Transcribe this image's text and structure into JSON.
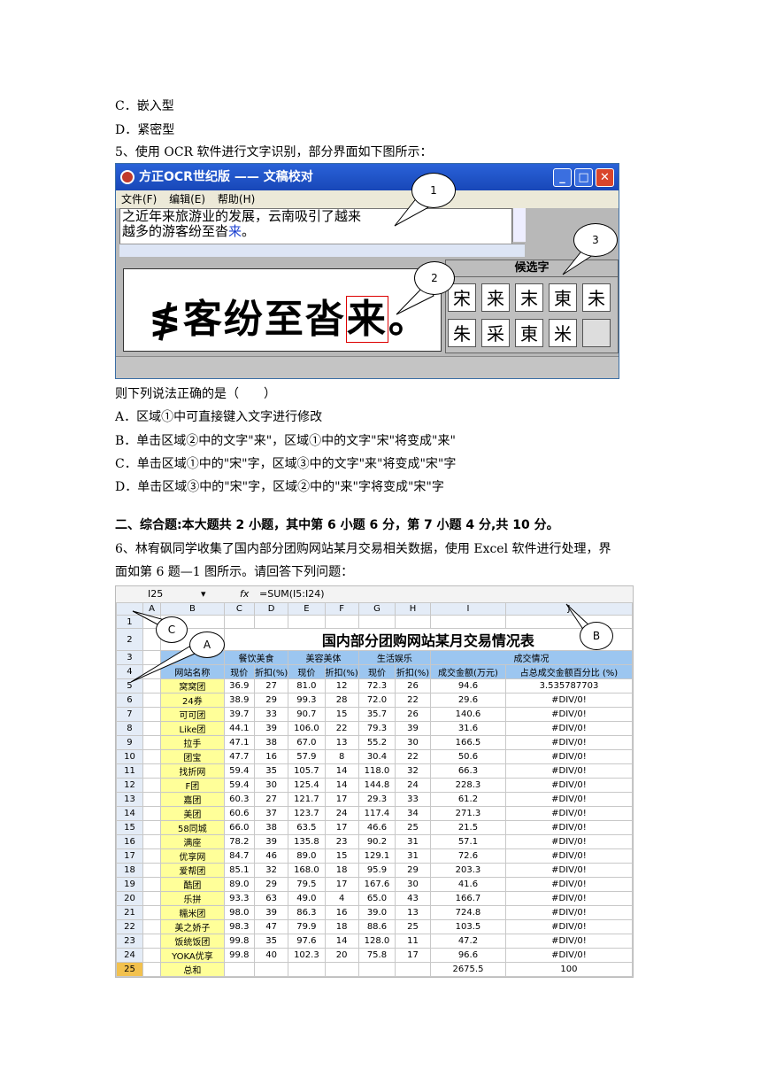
{
  "top_lines": [
    "C．嵌入型",
    "D．紧密型",
    "5、使用 OCR 软件进行文字识别，部分界面如下图所示："
  ],
  "ocr": {
    "title": "方正OCR世纪版  ——  文稿校对",
    "menu": [
      "文件(F)",
      "编辑(E)",
      "帮助(H)"
    ],
    "text_line1": "之近年来旅游业的发展，云南吸引了越来",
    "text_line2_prefix": "越多的游客纷至沓",
    "text_line2_highlight": "来",
    "text_line2_suffix": "。",
    "preview_prefix": "≸客纷至沓",
    "preview_highlight": "来",
    "preview_suffix": "。",
    "candidate_title": "候选字",
    "candidates": [
      "宋",
      "来",
      "末",
      "東",
      "未",
      "朱",
      "采",
      "東",
      "米",
      ""
    ]
  },
  "callouts": [
    "1",
    "2",
    "3"
  ],
  "question": {
    "stem": "则下列说法正确的是（　　）",
    "options": [
      "A．区域①中可直接键入文字进行修改",
      "B．单击区域②中的文字\"来\"，区域①中的文字\"宋\"将变成\"来\"",
      "C．单击区域①中的\"宋\"字，区域③中的文字\"来\"将变成\"宋\"字",
      "D．单击区域③中的\"宋\"字，区域②中的\"来\"字将变成\"宋\"字"
    ]
  },
  "section_title": "二、综合题:本大题共 2 小题，其中第 6 小题 6 分，第 7 小题 4 分,共 10 分。",
  "q6_line1": "6、林宥砜同学收集了国内部分团购网站某月交易相关数据，使用 Excel 软件进行处理，界",
  "q6_line2": "面如第 6 题—1 图所示。请回答下列问题：",
  "excel": {
    "cell_ref": "I25",
    "fx": "fx",
    "formula": "=SUM(I5:I24)",
    "columns": [
      "A",
      "B",
      "C",
      "D",
      "E",
      "F",
      "G",
      "H",
      "I",
      "J"
    ],
    "callouts": [
      "A",
      "B",
      "C"
    ],
    "title": "国内部分团购网站某月交易情况表",
    "group_headers": [
      "餐饮美食",
      "美容美体",
      "生活娱乐",
      "成交情况"
    ],
    "sub_headers": [
      "网站名称",
      "现价",
      "折扣(%)",
      "现价",
      "折扣(%)",
      "现价",
      "折扣(%)",
      "成交金额(万元)",
      "占总成交金额百分比 (%)"
    ],
    "rows": [
      [
        "5",
        "窝窝团",
        "36.9",
        "27",
        "81.0",
        "12",
        "72.3",
        "26",
        "94.6",
        "3.535787703"
      ],
      [
        "6",
        "24券",
        "38.9",
        "29",
        "99.3",
        "28",
        "72.0",
        "22",
        "29.6",
        "#DIV/0!"
      ],
      [
        "7",
        "可可团",
        "39.7",
        "33",
        "90.7",
        "15",
        "35.7",
        "26",
        "140.6",
        "#DIV/0!"
      ],
      [
        "8",
        "Like团",
        "44.1",
        "39",
        "106.0",
        "22",
        "79.3",
        "39",
        "31.6",
        "#DIV/0!"
      ],
      [
        "9",
        "拉手",
        "47.1",
        "38",
        "67.0",
        "13",
        "55.2",
        "30",
        "166.5",
        "#DIV/0!"
      ],
      [
        "10",
        "团宝",
        "47.7",
        "16",
        "57.9",
        "8",
        "30.4",
        "22",
        "50.6",
        "#DIV/0!"
      ],
      [
        "11",
        "找折网",
        "59.4",
        "35",
        "105.7",
        "14",
        "118.0",
        "32",
        "66.3",
        "#DIV/0!"
      ],
      [
        "12",
        "F团",
        "59.4",
        "30",
        "125.4",
        "14",
        "144.8",
        "24",
        "228.3",
        "#DIV/0!"
      ],
      [
        "13",
        "嘉团",
        "60.3",
        "27",
        "121.7",
        "17",
        "29.3",
        "33",
        "61.2",
        "#DIV/0!"
      ],
      [
        "14",
        "美团",
        "60.6",
        "37",
        "123.7",
        "24",
        "117.4",
        "34",
        "271.3",
        "#DIV/0!"
      ],
      [
        "15",
        "58同城",
        "66.0",
        "38",
        "63.5",
        "17",
        "46.6",
        "25",
        "21.5",
        "#DIV/0!"
      ],
      [
        "16",
        "满座",
        "78.2",
        "39",
        "135.8",
        "23",
        "90.2",
        "31",
        "57.1",
        "#DIV/0!"
      ],
      [
        "17",
        "优享网",
        "84.7",
        "46",
        "89.0",
        "15",
        "129.1",
        "31",
        "72.6",
        "#DIV/0!"
      ],
      [
        "18",
        "爱帮团",
        "85.1",
        "32",
        "168.0",
        "18",
        "95.9",
        "29",
        "203.3",
        "#DIV/0!"
      ],
      [
        "19",
        "酷团",
        "89.0",
        "29",
        "79.5",
        "17",
        "167.6",
        "30",
        "41.6",
        "#DIV/0!"
      ],
      [
        "20",
        "乐拼",
        "93.3",
        "63",
        "49.0",
        "4",
        "65.0",
        "43",
        "166.7",
        "#DIV/0!"
      ],
      [
        "21",
        "糯米团",
        "98.0",
        "39",
        "86.3",
        "16",
        "39.0",
        "13",
        "724.8",
        "#DIV/0!"
      ],
      [
        "22",
        "美之娇子",
        "98.3",
        "47",
        "79.9",
        "18",
        "88.6",
        "25",
        "103.5",
        "#DIV/0!"
      ],
      [
        "23",
        "饭统饭团",
        "99.8",
        "35",
        "97.6",
        "14",
        "128.0",
        "11",
        "47.2",
        "#DIV/0!"
      ],
      [
        "24",
        "YOKA优享",
        "99.8",
        "40",
        "102.3",
        "20",
        "75.8",
        "17",
        "96.6",
        "#DIV/0!"
      ],
      [
        "25",
        "总和",
        "",
        "",
        "",
        "",
        "",
        "",
        "2675.5",
        "100"
      ]
    ]
  }
}
